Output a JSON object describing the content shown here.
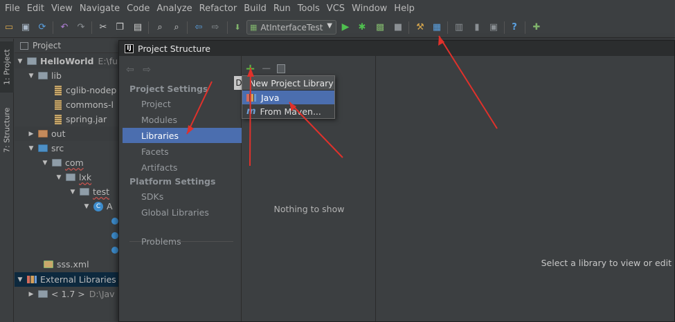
{
  "menu": [
    "File",
    "Edit",
    "View",
    "Navigate",
    "Code",
    "Analyze",
    "Refactor",
    "Build",
    "Run",
    "Tools",
    "VCS",
    "Window",
    "Help"
  ],
  "toolbar": {
    "run_config": "AtInterfaceTest",
    "icons": [
      "open-folder-icon",
      "save-icon",
      "sync-icon",
      "undo-icon",
      "redo-icon",
      "cut-icon",
      "copy-icon",
      "paste-icon",
      "find-icon",
      "replace-icon",
      "back-icon",
      "forward-icon",
      "run-icon",
      "debug-icon",
      "coverage-icon",
      "stop-icon",
      "settings-icon",
      "project-structure-icon",
      "sdk-icon",
      "device-icon",
      "android-icon",
      "help-icon",
      "plugin-icon"
    ]
  },
  "side_tabs": {
    "project": "1: Project",
    "structure": "7: Structure"
  },
  "project_panel": {
    "header": "Project",
    "tree": [
      {
        "label": "HelloWorld",
        "suffix": "E:\\fu",
        "kind": "module"
      },
      {
        "label": "lib",
        "kind": "folder"
      },
      {
        "label": "cglib-nodep",
        "kind": "jar"
      },
      {
        "label": "commons-l",
        "kind": "jar"
      },
      {
        "label": "spring.jar",
        "kind": "jar"
      },
      {
        "label": "out",
        "kind": "folder-out"
      },
      {
        "label": "src",
        "kind": "folder-src"
      },
      {
        "label": "com",
        "kind": "package"
      },
      {
        "label": "lxk",
        "kind": "package"
      },
      {
        "label": "test",
        "kind": "package"
      },
      {
        "label": "A",
        "kind": "class"
      },
      {
        "label": "sss.xml",
        "kind": "xml"
      },
      {
        "label": "External Libraries",
        "kind": "libraries"
      },
      {
        "label": "< 1.7 >",
        "suffix": "D:\\Jav",
        "kind": "sdk"
      }
    ]
  },
  "dialog": {
    "title": "Project Structure",
    "section_project": "Project Settings",
    "nav_project": [
      "Project",
      "Modules",
      "Libraries",
      "Facets",
      "Artifacts"
    ],
    "section_platform": "Platform Settings",
    "nav_platform": [
      "SDKs",
      "Global Libraries"
    ],
    "nav_problems": "Problems",
    "selected": "Libraries",
    "middle_empty": "Nothing to show",
    "right_empty": "Select a library to view or edit",
    "tooltip_letter": "D"
  },
  "popup": {
    "title": "New Project Library",
    "items": [
      "Java",
      "From Maven..."
    ],
    "selected": "Java"
  },
  "colors": {
    "selection": "#4b6eaf",
    "background": "#3c3f41",
    "arrow": "#e0312b",
    "add": "#62b543"
  }
}
